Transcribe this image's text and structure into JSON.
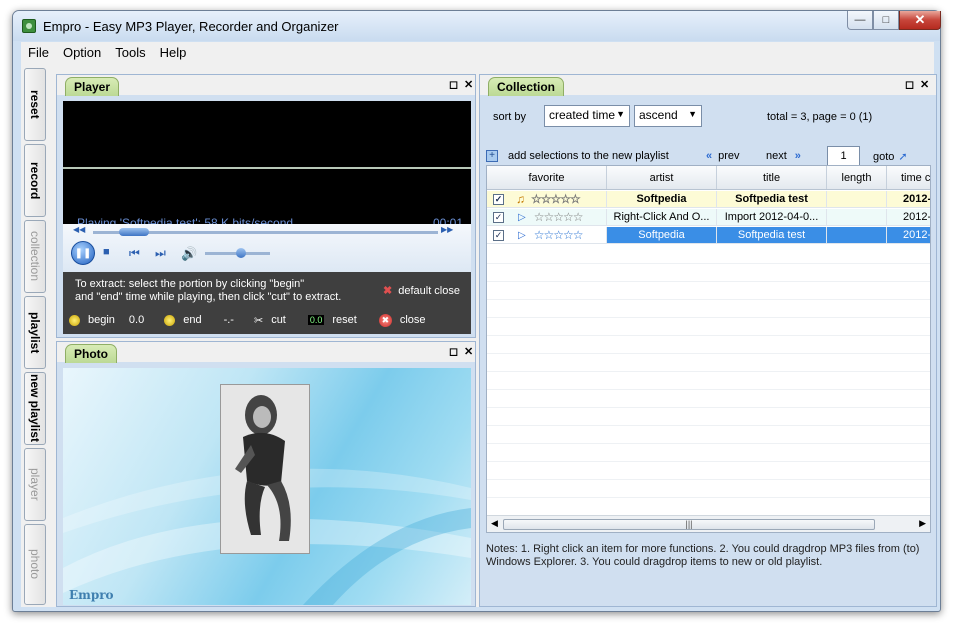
{
  "window": {
    "title": "Empro - Easy MP3 Player, Recorder and Organizer",
    "min": "—",
    "max": "□",
    "close": "✕"
  },
  "menu": [
    "File",
    "Option",
    "Tools",
    "Help"
  ],
  "sidetabs": [
    {
      "label": "reset",
      "state": "active"
    },
    {
      "label": "record",
      "state": "active"
    },
    {
      "label": "collection",
      "state": "dim"
    },
    {
      "label": "playlist",
      "state": "active"
    },
    {
      "label": "new playlist",
      "state": "active"
    },
    {
      "label": "player",
      "state": "dim"
    },
    {
      "label": "photo",
      "state": "dim"
    }
  ],
  "player": {
    "tab": "Player",
    "status": "Playing 'Softpedia test': 58 K bits/second",
    "time": "00:01",
    "progress": 0.11,
    "volume": 0.55,
    "extract": {
      "instruction_1": "To extract: select the portion by clicking \"begin\"",
      "instruction_2": "and \"end\" time while playing, then click \"cut\" to extract.",
      "default_close": "default close",
      "begin": "begin",
      "begin_value": "0.0",
      "end": "end",
      "end_value": "-.-",
      "cut": "cut",
      "reset_value": "0.0",
      "reset": "reset",
      "close": "close"
    }
  },
  "photo": {
    "tab": "Photo",
    "brand": "Empro"
  },
  "collection": {
    "tab": "Collection",
    "sort_label": "sort by",
    "sort_field": "created time",
    "sort_order": "ascend",
    "total": "total = 3, page = 0 (1)",
    "add_selection": "add selections to the new playlist",
    "prev": "prev",
    "next": "next",
    "page": "1",
    "goto": "goto",
    "columns": [
      "favorite",
      "artist",
      "title",
      "length",
      "time c"
    ],
    "rows": [
      {
        "artist": "Softpedia",
        "title": "Softpedia test",
        "length": "",
        "time": "2012-",
        "style": "playing"
      },
      {
        "artist": "Right-Click And O...",
        "title": "Import 2012-04-0...",
        "length": "",
        "time": "2012-",
        "style": "normal"
      },
      {
        "artist": "Softpedia",
        "title": "Softpedia test",
        "length": "",
        "time": "2012-",
        "style": "selected"
      }
    ],
    "notes": "Notes: 1. Right click an item for more functions. 2. You could dragdrop MP3 files from (to) Windows Explorer. 3. You could dragdrop items to new or old playlist."
  },
  "colors": {
    "accent_tab": "#c6e09e",
    "selected_row": "#3a8ee6",
    "playing_row": "#fdfbd6",
    "panel_bg": "#d0dff0"
  }
}
